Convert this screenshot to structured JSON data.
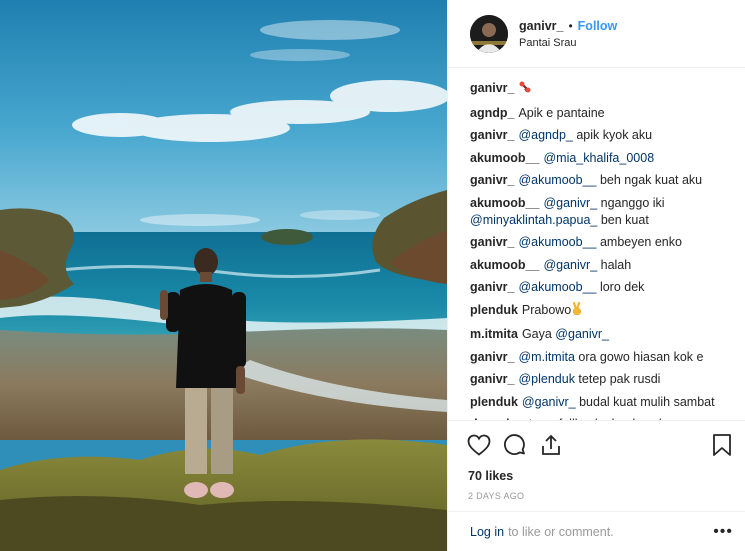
{
  "header": {
    "username": "ganivr_",
    "separator": "•",
    "follow_label": "Follow",
    "location": "Pantai Srau"
  },
  "comments": [
    {
      "user": "ganivr_",
      "parts": [
        {
          "t": "emoji",
          "v": "dumbbell-emoji"
        }
      ]
    },
    {
      "user": "agndp_",
      "parts": [
        {
          "t": "text",
          "v": "Apik e pantaine"
        }
      ]
    },
    {
      "user": "ganivr_",
      "parts": [
        {
          "t": "mention",
          "v": "@agndp_"
        },
        {
          "t": "text",
          "v": " apik kyok aku"
        }
      ]
    },
    {
      "user": "akumoob__",
      "parts": [
        {
          "t": "mention",
          "v": "@mia_khalifa_0008"
        }
      ]
    },
    {
      "user": "ganivr_",
      "parts": [
        {
          "t": "mention",
          "v": "@akumoob__"
        },
        {
          "t": "text",
          "v": " beh ngak kuat aku"
        }
      ]
    },
    {
      "user": "akumoob__",
      "parts": [
        {
          "t": "mention",
          "v": "@ganivr_"
        },
        {
          "t": "text",
          "v": " nganggo iki "
        },
        {
          "t": "mention",
          "v": "@minyaklintah.papua_"
        },
        {
          "t": "text",
          "v": " ben kuat"
        }
      ]
    },
    {
      "user": "ganivr_",
      "parts": [
        {
          "t": "mention",
          "v": "@akumoob__"
        },
        {
          "t": "text",
          "v": " ambeyen enko"
        }
      ]
    },
    {
      "user": "akumoob__",
      "parts": [
        {
          "t": "mention",
          "v": "@ganivr_"
        },
        {
          "t": "text",
          "v": " halah"
        }
      ]
    },
    {
      "user": "ganivr_",
      "parts": [
        {
          "t": "mention",
          "v": "@akumoob__"
        },
        {
          "t": "text",
          "v": " loro dek"
        }
      ]
    },
    {
      "user": "plenduk",
      "parts": [
        {
          "t": "text",
          "v": "Prabowo"
        },
        {
          "t": "emoji",
          "v": "victory-hand-emoji"
        }
      ]
    },
    {
      "user": "m.itmita",
      "parts": [
        {
          "t": "text",
          "v": "Gaya "
        },
        {
          "t": "mention",
          "v": "@ganivr_"
        }
      ]
    },
    {
      "user": "ganivr_",
      "parts": [
        {
          "t": "mention",
          "v": "@m.itmita"
        },
        {
          "t": "text",
          "v": " ora gowo hiasan kok e"
        }
      ]
    },
    {
      "user": "ganivr_",
      "parts": [
        {
          "t": "mention",
          "v": "@plenduk"
        },
        {
          "t": "text",
          "v": " tetep pak rusdi"
        }
      ]
    },
    {
      "user": "plenduk",
      "parts": [
        {
          "t": "mention",
          "v": "@ganivr_"
        },
        {
          "t": "text",
          "v": " budal kuat mulih sambat"
        }
      ]
    },
    {
      "user": "devapirestu",
      "parts": [
        {
          "t": "text",
          "v": "ra fallback aku duso love we"
        }
      ]
    }
  ],
  "actions": {
    "like_icon": "heart-icon",
    "comment_icon": "comment-icon",
    "share_icon": "share-icon",
    "save_icon": "bookmark-icon",
    "likes": "70 likes",
    "date": "2 DAYS AGO"
  },
  "footer": {
    "login_label": "Log in",
    "rest_label": "to like or comment.",
    "more_label": "•••"
  },
  "colors": {
    "link": "#003569",
    "follow": "#3897f0",
    "text": "#262626",
    "muted": "#999999"
  }
}
